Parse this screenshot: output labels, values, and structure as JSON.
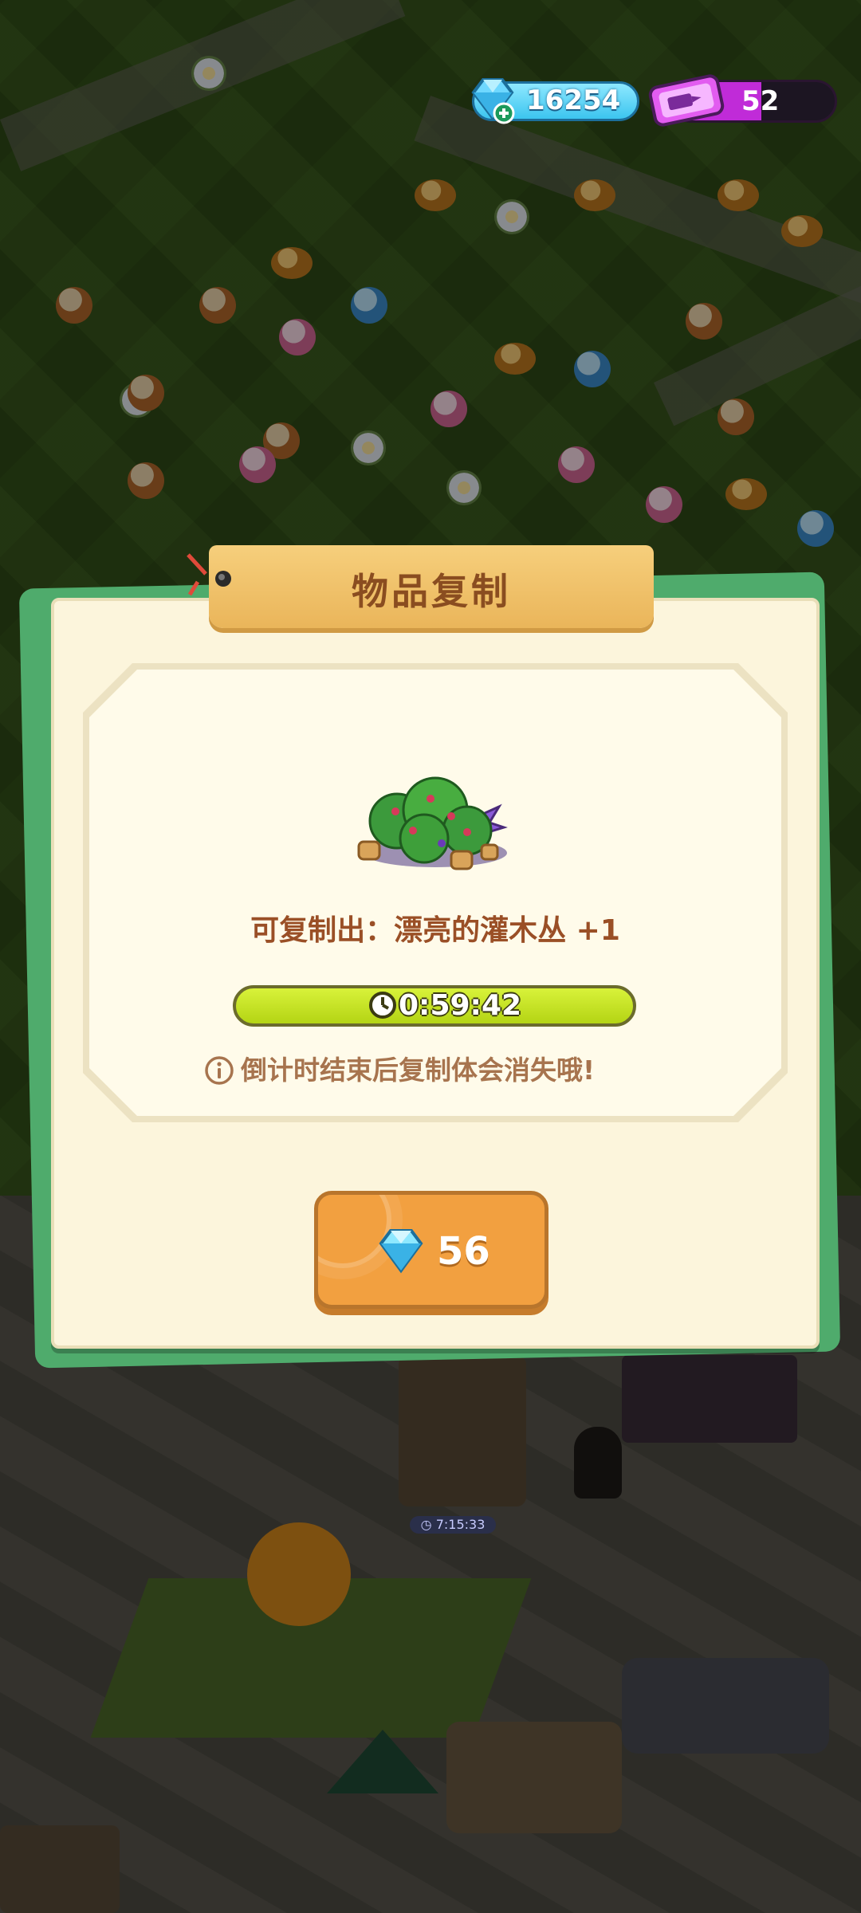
{
  "hud": {
    "gems_value": "16254",
    "tickets_value": "52",
    "gem_icon": "gem-plus-icon",
    "ticket_icon": "ticket-icon"
  },
  "dialog": {
    "title": "物品复制",
    "item_icon": "bush-item-icon",
    "copy_line": "可复制出：漂亮的灌木丛  +1",
    "timer": "0:59:42",
    "info_text": "倒计时结束后复制体会消失哦!",
    "buy_price": "56",
    "buy_icon": "gem-icon"
  },
  "world": {
    "building_timer": "7:15:33"
  },
  "colors": {
    "dialog_bg": "#fcf5dc",
    "dialog_back": "#4fab6c",
    "title_tab": "#eab55a",
    "title_text": "#8a4d20",
    "timer_bar": "#c4e020",
    "buy_button": "#f2a040",
    "gem_blue": "#3cc5ef",
    "ticket_purple": "#c02bd8"
  }
}
